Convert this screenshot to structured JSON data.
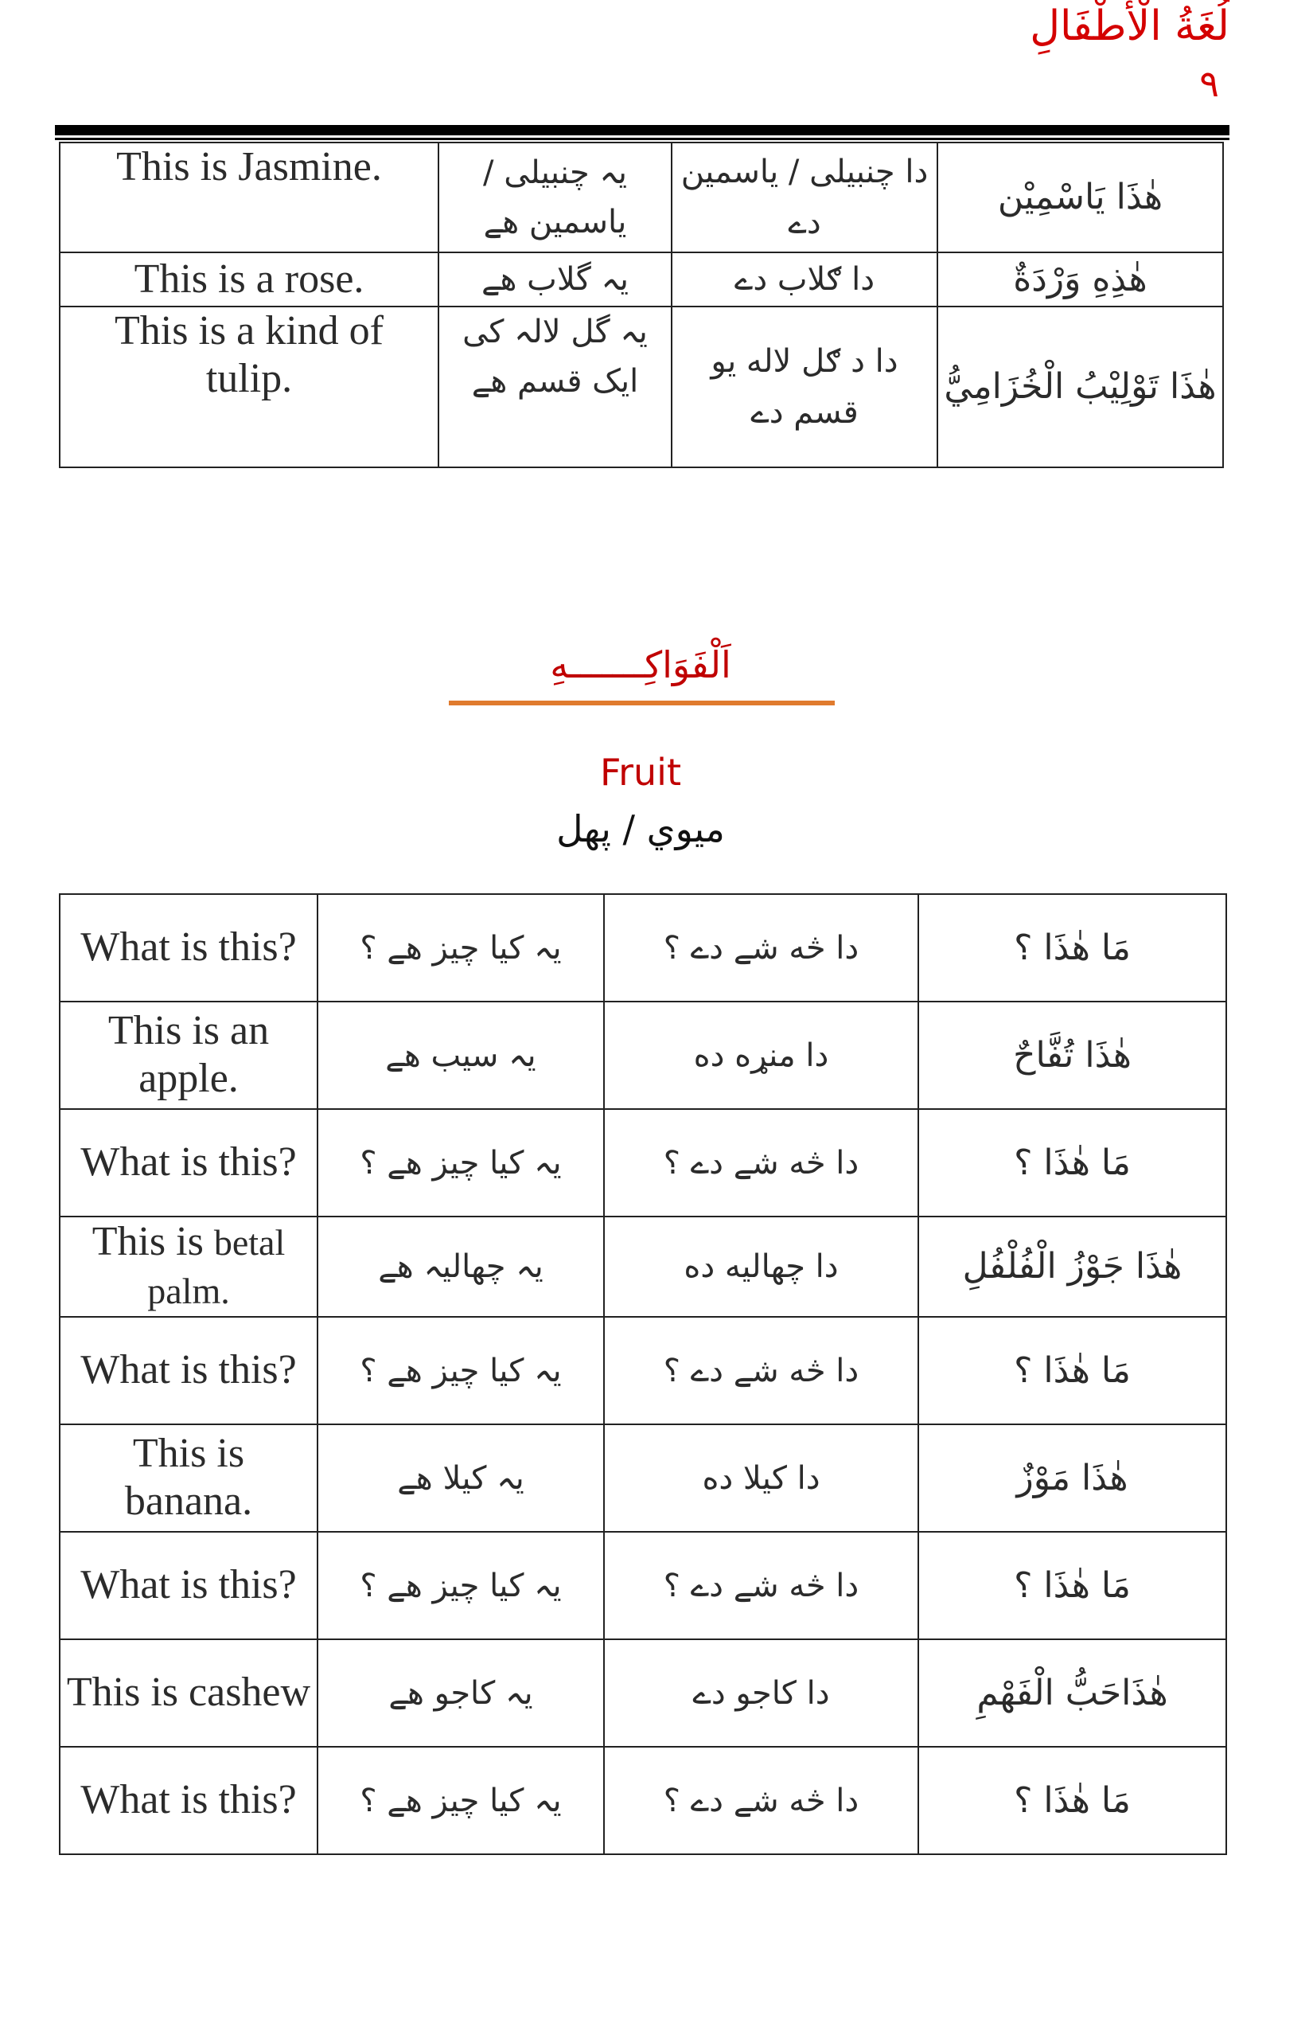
{
  "header": {
    "title": "لُغَةُ الْأَطْفَالِ",
    "page_number": "٩"
  },
  "flowers_table": {
    "rows": [
      {
        "english": "This is Jasmine.",
        "urdu": "یہ چنبیلی / یاسمین ھے",
        "pashto": "دا چنبیلی / یاسمین دے",
        "arabic": "هٰذَا يَاسْمِيْن"
      },
      {
        "english": "This is a rose.",
        "urdu": "یہ گلاب ھے",
        "pashto": "دا ګلاب دے",
        "arabic": "هٰذِهِ وَرْدَةٌ"
      },
      {
        "english": "This is a kind of tulip.",
        "urdu": "یہ گل لالہ کی ایک قسم ھے",
        "pashto": "دا د ګل لاله یو قسم دے",
        "arabic": "هٰذَا تَوْلِيْبُ الْخُزَامِيُّ"
      }
    ]
  },
  "fruit_section": {
    "arabic_title": "اَلْفَوَاكِـــــــهِ",
    "english_title": "Fruit",
    "urdu_title": "میوي / پھل"
  },
  "fruit_table": {
    "rows": [
      {
        "english": "What is this?",
        "english_small": "",
        "urdu": "یہ کیا چیز ھے ؟",
        "pashto": "دا څه شے دے ؟",
        "arabic": "مَا هٰذَا ؟"
      },
      {
        "english": "This is an apple.",
        "english_small": "",
        "urdu": "یہ سیب ھے",
        "pashto": "دا منړه ده",
        "arabic": "هٰذَا تُفَّاحٌ"
      },
      {
        "english": "What is this?",
        "english_small": "",
        "urdu": "یہ کیا چیز ھے ؟",
        "pashto": "دا څه شے دے ؟",
        "arabic": "مَا هٰذَا ؟"
      },
      {
        "english": "This is ",
        "english_small": "betal palm.",
        "urdu": "یہ چھالیہ ھے",
        "pashto": "دا چھالیه ده",
        "arabic": "هٰذَا جَوْزُ الْفُلْفُلِ"
      },
      {
        "english": "What is this?",
        "english_small": "",
        "urdu": "یہ کیا چیز ھے ؟",
        "pashto": "دا څه شے دے ؟",
        "arabic": "مَا هٰذَا ؟"
      },
      {
        "english": "This is banana.",
        "english_small": "",
        "urdu": "یہ کیلا ھے",
        "pashto": "دا کیلا ده",
        "arabic": "هٰذَا مَوْزٌ"
      },
      {
        "english": "What is this?",
        "english_small": "",
        "urdu": "یہ کیا چیز ھے ؟",
        "pashto": "دا څه شے دے ؟",
        "arabic": "مَا هٰذَا ؟"
      },
      {
        "english": "This is cashew",
        "english_small": "",
        "urdu": "یہ کاجو ھے",
        "pashto": "دا کاجو دے",
        "arabic": "هٰذَاحَبُّ الْفَهْمِ"
      },
      {
        "english": "What is this?",
        "english_small": "",
        "urdu": "یہ کیا چیز ھے ؟",
        "pashto": "دا څه شے دے ؟",
        "arabic": "مَا هٰذَا ؟"
      }
    ]
  },
  "colors": {
    "arabic_text": "#b30000",
    "header_red": "#d40000",
    "section_rule": "#e07b2e",
    "body_text": "#2b2b2b"
  }
}
